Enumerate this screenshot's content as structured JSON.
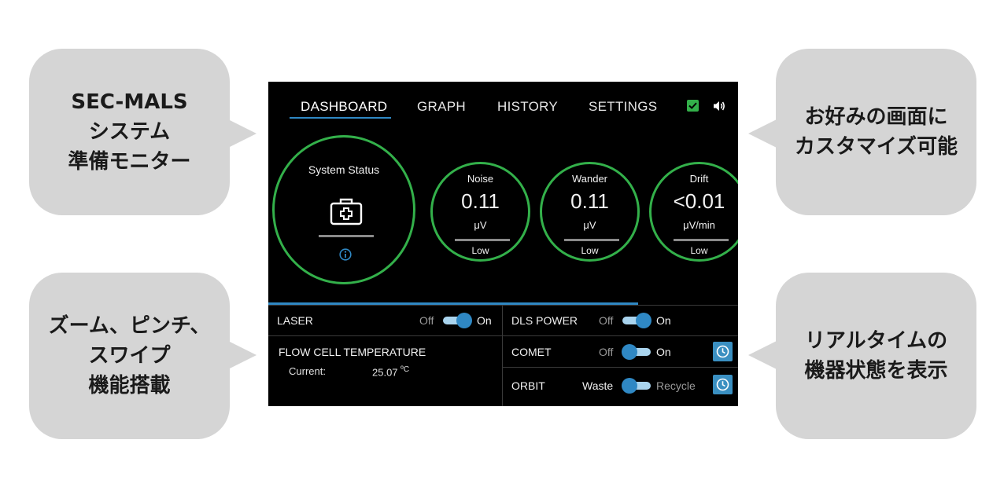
{
  "callouts": {
    "top_left": [
      "SEC-MALS",
      "システム",
      "準備モニター"
    ],
    "bottom_left": [
      "ズーム、ピンチ、",
      "スワイプ",
      "機能搭載"
    ],
    "top_right": [
      "お好みの画面に",
      "カスタマイズ可能"
    ],
    "bottom_right": [
      "リアルタイムの",
      "機器状態を表示"
    ]
  },
  "tabs": {
    "dashboard": "DASHBOARD",
    "graph": "GRAPH",
    "history": "HISTORY",
    "settings": "SETTINGS",
    "active": "DASHBOARD"
  },
  "system_status": {
    "title": "System Status"
  },
  "gauges": [
    {
      "name": "Noise",
      "value": "0.11",
      "unit": "μV",
      "level": "Low"
    },
    {
      "name": "Wander",
      "value": "0.11",
      "unit": "μV",
      "level": "Low"
    },
    {
      "name": "Drift",
      "value": "<0.01",
      "unit": "μV/min",
      "level": "Low"
    }
  ],
  "laser": {
    "label": "LASER",
    "off": "Off",
    "on": "On",
    "state": "on"
  },
  "flow_cell": {
    "label": "FLOW CELL TEMPERATURE",
    "current_label": "Current:",
    "current_value": "25.07",
    "unit": "ºC"
  },
  "dls_power": {
    "label": "DLS POWER",
    "off": "Off",
    "on": "On",
    "state": "on"
  },
  "comet": {
    "label": "COMET",
    "off": "Off",
    "on": "On",
    "state": "off"
  },
  "orbit": {
    "label": "ORBIT",
    "left": "Waste",
    "right": "Recycle",
    "state": "waste"
  },
  "colors": {
    "accent": "#2f88c4",
    "ok_green": "#33b04a",
    "callout_bg": "#d5d5d5"
  }
}
